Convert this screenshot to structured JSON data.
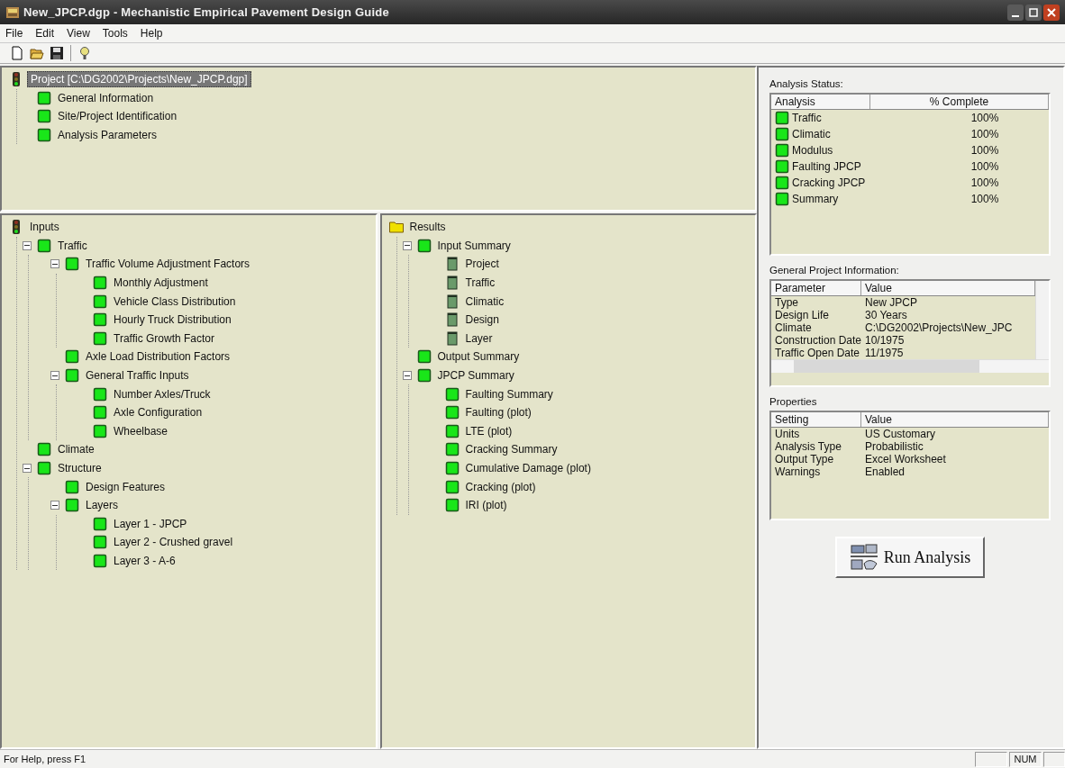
{
  "window": {
    "title": "New_JPCP.dgp - Mechanistic Empirical Pavement Design Guide"
  },
  "menu": [
    "File",
    "Edit",
    "View",
    "Tools",
    "Help"
  ],
  "project_tree": {
    "label": "Project [C:\\DG2002\\Projects\\New_JPCP.dgp]",
    "kind": "lights",
    "selected": true,
    "children": [
      {
        "label": "General Information",
        "kind": "green",
        "selected": false
      },
      {
        "label": "Site/Project Identification",
        "kind": "green",
        "selected": false
      },
      {
        "label": "Analysis Parameters",
        "kind": "green",
        "selected": false
      }
    ]
  },
  "inputs_tree": {
    "label": "Inputs",
    "kind": "lights",
    "selected": false,
    "children": [
      {
        "label": "Traffic",
        "kind": "green",
        "selected": false,
        "expanded": true,
        "children": [
          {
            "label": "Traffic Volume Adjustment Factors",
            "kind": "green",
            "selected": false,
            "expanded": true,
            "children": [
              {
                "label": "Monthly Adjustment",
                "kind": "green",
                "selected": false
              },
              {
                "label": "Vehicle Class Distribution",
                "kind": "green",
                "selected": false
              },
              {
                "label": "Hourly Truck Distribution",
                "kind": "green",
                "selected": false
              },
              {
                "label": "Traffic Growth Factor",
                "kind": "green",
                "selected": false
              }
            ]
          },
          {
            "label": "Axle Load Distribution Factors",
            "kind": "green",
            "selected": false
          },
          {
            "label": "General Traffic Inputs",
            "kind": "green",
            "selected": false,
            "expanded": true,
            "children": [
              {
                "label": "Number Axles/Truck",
                "kind": "green",
                "selected": false
              },
              {
                "label": "Axle Configuration",
                "kind": "green",
                "selected": false
              },
              {
                "label": "Wheelbase",
                "kind": "green",
                "selected": false
              }
            ]
          }
        ]
      },
      {
        "label": "Climate",
        "kind": "green",
        "selected": false
      },
      {
        "label": "Structure",
        "kind": "green",
        "selected": false,
        "expanded": true,
        "children": [
          {
            "label": "Design Features",
            "kind": "green",
            "selected": false
          },
          {
            "label": "Layers",
            "kind": "green",
            "selected": false,
            "expanded": true,
            "children": [
              {
                "label": "Layer 1 - JPCP",
                "kind": "green",
                "selected": false
              },
              {
                "label": "Layer 2 - Crushed gravel",
                "kind": "green",
                "selected": false
              },
              {
                "label": "Layer 3 - A-6",
                "kind": "green",
                "selected": false
              }
            ]
          }
        ]
      }
    ]
  },
  "results_tree": {
    "label": "Results",
    "kind": "folder",
    "selected": false,
    "children": [
      {
        "label": "Input Summary",
        "kind": "green",
        "selected": false,
        "expanded": true,
        "children": [
          {
            "label": "Project",
            "kind": "report",
            "selected": false
          },
          {
            "label": "Traffic",
            "kind": "report",
            "selected": false
          },
          {
            "label": "Climatic",
            "kind": "report",
            "selected": false
          },
          {
            "label": "Design",
            "kind": "report",
            "selected": false
          },
          {
            "label": "Layer",
            "kind": "report",
            "selected": false
          }
        ]
      },
      {
        "label": "Output Summary",
        "kind": "green",
        "selected": false
      },
      {
        "label": "JPCP Summary",
        "kind": "green",
        "selected": false,
        "expanded": true,
        "children": [
          {
            "label": "Faulting Summary",
            "kind": "green",
            "selected": false
          },
          {
            "label": "Faulting (plot)",
            "kind": "green",
            "selected": false
          },
          {
            "label": "LTE (plot)",
            "kind": "green",
            "selected": false
          },
          {
            "label": "Cracking Summary",
            "kind": "green",
            "selected": false
          },
          {
            "label": "Cumulative Damage (plot)",
            "kind": "green",
            "selected": false
          },
          {
            "label": "Cracking (plot)",
            "kind": "green",
            "selected": false
          },
          {
            "label": "IRI (plot)",
            "kind": "green",
            "selected": false
          }
        ]
      }
    ]
  },
  "analysis_status": {
    "label": "Analysis Status:",
    "columns": [
      "Analysis",
      "% Complete"
    ],
    "rows": [
      {
        "name": "Traffic",
        "complete": "100%"
      },
      {
        "name": "Climatic",
        "complete": "100%"
      },
      {
        "name": "Modulus",
        "complete": "100%"
      },
      {
        "name": "Faulting JPCP",
        "complete": "100%"
      },
      {
        "name": "Cracking JPCP",
        "complete": "100%"
      },
      {
        "name": "Summary",
        "complete": "100%"
      }
    ]
  },
  "general_info": {
    "label": "General Project Information:",
    "columns": [
      "Parameter",
      "Value"
    ],
    "rows": [
      {
        "parameter": "Type",
        "value": "New JPCP"
      },
      {
        "parameter": "Design Life",
        "value": "30 Years"
      },
      {
        "parameter": "Climate",
        "value": "C:\\DG2002\\Projects\\New_JPC"
      },
      {
        "parameter": "Construction Date",
        "value": "10/1975"
      },
      {
        "parameter": "Traffic Open Date",
        "value": "11/1975"
      }
    ]
  },
  "properties": {
    "label": "Properties",
    "columns": [
      "Setting",
      "Value"
    ],
    "rows": [
      {
        "parameter": "Units",
        "value": "US Customary"
      },
      {
        "parameter": "Analysis Type",
        "value": "Probabilistic"
      },
      {
        "parameter": "Output Type",
        "value": "Excel Worksheet"
      },
      {
        "parameter": "Warnings",
        "value": "Enabled"
      }
    ]
  },
  "run_button": {
    "label": "Run Analysis"
  },
  "status_bar": {
    "help_text": "For Help, press F1",
    "indicators": [
      "NUM"
    ]
  }
}
